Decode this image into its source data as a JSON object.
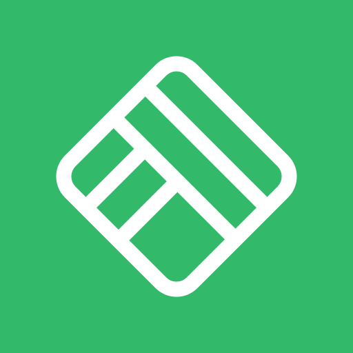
{
  "icon": {
    "name": "layout-grid-logo-icon",
    "background_color": "#32BA6A",
    "foreground_color": "#FFFFFF"
  }
}
